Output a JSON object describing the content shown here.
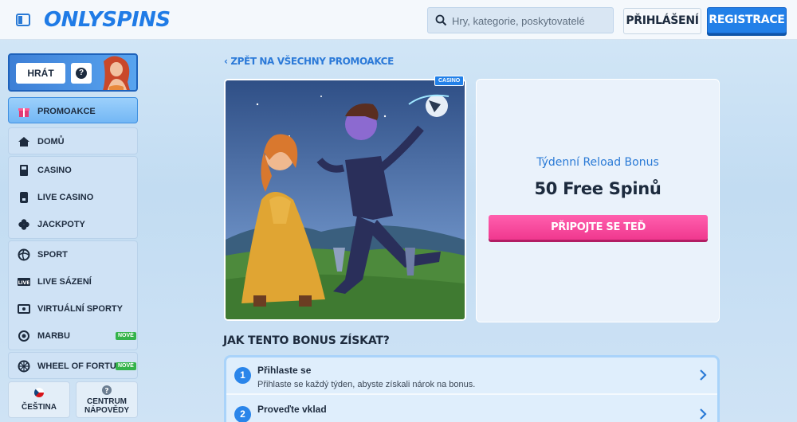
{
  "header": {
    "logo_part1": "ONLY",
    "logo_part2": "SPINS",
    "search_placeholder": "Hry, kategorie, poskytovatelé",
    "login_label": "PŘIHLÁŠENÍ",
    "register_label": "REGISTRACE"
  },
  "sidebar": {
    "promo_card": {
      "play_label": "HRÁT"
    },
    "active_item": {
      "label": "PROMOAKCE",
      "icon": "gift-icon"
    },
    "groups": [
      {
        "items": [
          {
            "label": "DOMŮ",
            "icon": "home-icon"
          }
        ]
      },
      {
        "items": [
          {
            "label": "CASINO",
            "icon": "slot-machine-icon"
          },
          {
            "label": "LIVE CASINO",
            "icon": "card-icon"
          },
          {
            "label": "JACKPOTY",
            "icon": "clover-icon"
          }
        ]
      },
      {
        "items": [
          {
            "label": "SPORT",
            "icon": "ball-icon"
          },
          {
            "label": "LIVE SÁZENÍ",
            "icon": "live-icon"
          },
          {
            "label": "VIRTUÁLNÍ SPORTY",
            "icon": "virtual-sports-icon"
          },
          {
            "label": "MARBU",
            "icon": "marbu-icon",
            "badge": "NOVÉ"
          }
        ]
      },
      {
        "items": [
          {
            "label": "WHEEL OF FORTUNE",
            "icon": "wheel-icon",
            "badge": "NOVÉ"
          }
        ]
      }
    ],
    "language_label": "ČEŠTINA",
    "help_center_line1": "CENTRUM",
    "help_center_line2": "NÁPOVĚDY"
  },
  "main": {
    "back_link": "ZPĚT NA VŠECHNY PROMOAKCE",
    "image_tag": "CASINO",
    "offer": {
      "subtitle": "Týdenní Reload Bonus",
      "title": "50 Free Spinů",
      "cta_label": "PŘIPOJTE SE TEĎ"
    },
    "how_title": "JAK TENTO BONUS ZÍSKAT?",
    "steps": [
      {
        "number": "1",
        "title": "Přihlaste se",
        "description": "Přihlaste se každý týden, abyste získali nárok na bonus."
      },
      {
        "number": "2",
        "title": "Proveďte vklad",
        "description": ""
      }
    ]
  },
  "colors": {
    "accent": "#2280e8",
    "cta": "#f0388f",
    "badge_new": "#34b34a"
  }
}
